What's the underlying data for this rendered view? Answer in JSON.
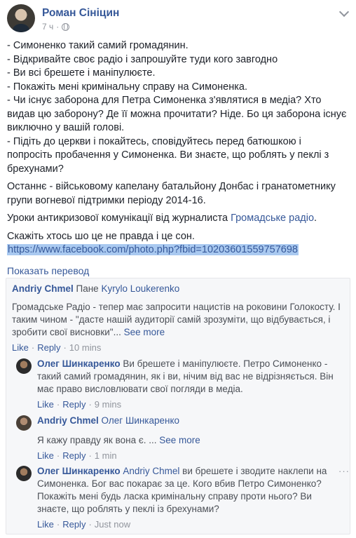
{
  "post": {
    "author": "Роман Сініцин",
    "time": "7 ч",
    "lines": [
      "- Симоненко такий самий громадянин.",
      "- Відкривайте своє радіо і запрошуйте туди кого завгодно",
      "- Ви всі брешете і маніпулюєте.",
      "- Покажіть мені кримінальну справу на Симоненка.",
      "- Чи існує заборона для Петра Симоненка з'являтися в медіа? Хто",
      "видав цю заборону? Де її можна прочитати? Ніде. Бо ця заборона існує",
      "виключно у вашій голові.",
      "- Підіть до церкви і покайтесь, сповідуйтесь перед батюшкою і",
      "попросіть пробачення у Симоненка. Ви знаєте, що роблять у пеклі з",
      "брехунами?"
    ],
    "para2": [
      "Останнє - військовому капелану батальйону Донбас і гранатометнику",
      "групи вогневої підтримки періоду 2014-16."
    ],
    "para3_text": "Уроки антикризової комунікації від журналиста ",
    "para3_link": "Громадське радіо",
    "para3_end": ".",
    "para4": "Скажіть хтось шо це не правда і це сон.",
    "url": "https://www.facebook.com/photo.php?fbid=10203601559757698",
    "translate": "Показать перевод"
  },
  "comments": [
    {
      "name": "Andriy Chmel",
      "pre": " Пане ",
      "tag": "Kyrylo Loukerenko",
      "text": [
        "Громадське Радіо - тепер має запросити нацистів на роковини Голокосту. І",
        "таким чином - \"дасте нашій аудиторії самій зрозуміти, що відбувається, і",
        "зробити свої висновки\"... "
      ],
      "see_more": "See more",
      "like": "Like",
      "reply": "Reply",
      "time": "10 mins"
    },
    {
      "name": "Олег Шинкаренко",
      "first": " Ви брешете і маніпулюєте. Петро Симоненко -",
      "text": [
        "такий самий громадянин, як і ви, нічим від вас не відрізняється. Він",
        "має право висловлювати свої погляди в медіа."
      ],
      "like": "Like",
      "reply": "Reply",
      "time": "9 mins"
    },
    {
      "name": "Andriy Chmel",
      "tag": "Олег Шинкаренко",
      "text": "Я кажу правду як вона є. ... ",
      "see_more": "See more",
      "like": "Like",
      "reply": "Reply",
      "time": "1 min"
    },
    {
      "name": "Олег Шинкаренко",
      "tag": "Andriy Chmel",
      "first": " ви брешете і зводите наклепи на",
      "text": [
        "Симоненка. Бог вас покарає за це. Кого вбив Петро Симоненко?",
        "Покажіть мені будь ласка кримінальну справу проти нього? Ви",
        "знаєте, що роблять у пеклі із брехунами?"
      ],
      "like": "Like",
      "reply": "Reply",
      "time": "Just now",
      "more": "···"
    }
  ]
}
